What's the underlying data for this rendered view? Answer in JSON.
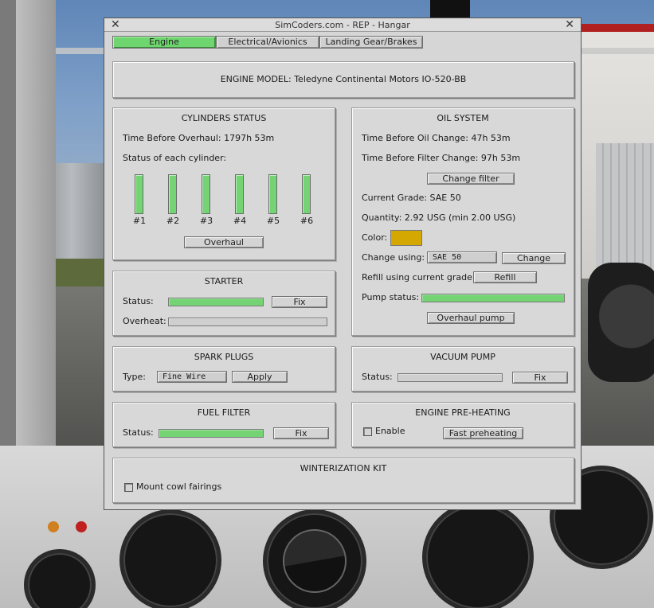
{
  "window": {
    "title": "SimCoders.com - REP - Hangar"
  },
  "tabs": [
    {
      "label": "Engine",
      "active": true
    },
    {
      "label": "Electrical/Avionics",
      "active": false
    },
    {
      "label": "Landing Gear/Brakes",
      "active": false
    }
  ],
  "engine_model": {
    "text": "ENGINE MODEL: Teledyne Continental Motors IO-520-BB"
  },
  "cylinders": {
    "title": "CYLINDERS STATUS",
    "time_before_overhaul": "Time Before Overhaul: 1797h 53m",
    "status_label": "Status of each cylinder:",
    "items": [
      {
        "label": "#1",
        "health": 1.0
      },
      {
        "label": "#2",
        "health": 1.0
      },
      {
        "label": "#3",
        "health": 1.0
      },
      {
        "label": "#4",
        "health": 1.0
      },
      {
        "label": "#5",
        "health": 1.0
      },
      {
        "label": "#6",
        "health": 1.0
      }
    ],
    "overhaul_button": "Overhaul"
  },
  "oil": {
    "title": "OIL SYSTEM",
    "time_before_oil_change": "Time Before Oil Change: 47h 53m",
    "time_before_filter_change": "Time Before Filter Change: 97h 53m",
    "change_filter_button": "Change filter",
    "current_grade": "Current Grade: SAE 50",
    "quantity": "Quantity: 2.92 USG (min 2.00 USG)",
    "color_label": "Color:",
    "color_value": "#d4a800",
    "change_using_label": "Change using:",
    "change_using_value": "SAE 50",
    "change_button": "Change",
    "refill_label": "Refill using current grade:",
    "refill_button": "Refill",
    "pump_status_label": "Pump status:",
    "pump_status_level": 1.0,
    "overhaul_pump_button": "Overhaul pump"
  },
  "starter": {
    "title": "STARTER",
    "status_label": "Status:",
    "status_level": 1.0,
    "fix_button": "Fix",
    "overheat_label": "Overheat:",
    "overheat_level": 0.0
  },
  "spark_plugs": {
    "title": "SPARK PLUGS",
    "type_label": "Type:",
    "type_value": "Fine Wire",
    "apply_button": "Apply"
  },
  "vacuum_pump": {
    "title": "VACUUM PUMP",
    "status_label": "Status:",
    "status_level": 0.0,
    "fix_button": "Fix"
  },
  "fuel_filter": {
    "title": "FUEL FILTER",
    "status_label": "Status:",
    "status_level": 1.0,
    "fix_button": "Fix"
  },
  "preheating": {
    "title": "ENGINE PRE-HEATING",
    "enable_label": "Enable",
    "enabled": false,
    "fast_button": "Fast preheating"
  },
  "winterization": {
    "title": "WINTERIZATION KIT",
    "mount_label": "Mount cowl fairings",
    "mounted": false
  },
  "colors": {
    "active_tab": "#6fd66f",
    "status_ok": "#74d474",
    "dialog_bg": "#d6d6d6"
  }
}
